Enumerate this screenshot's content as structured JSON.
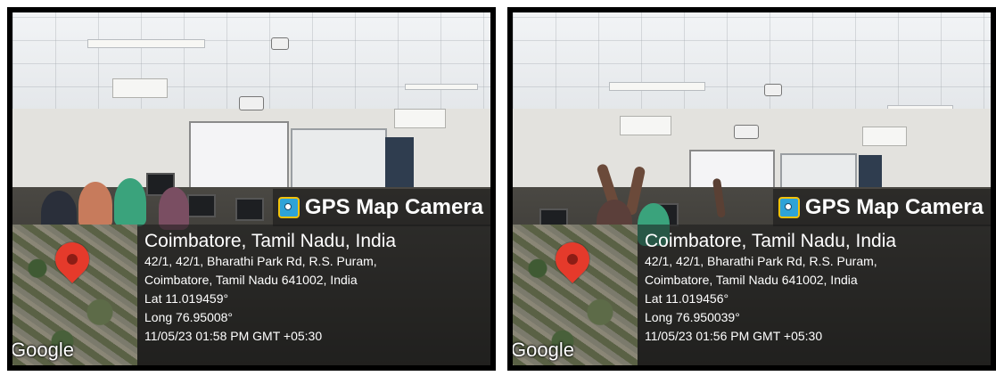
{
  "photos": [
    {
      "app_title": "GPS Map Camera",
      "location_title": "Coimbatore, Tamil Nadu, India",
      "address_line1": "42/1, 42/1, Bharathi Park Rd, R.S. Puram,",
      "address_line2": "Coimbatore, Tamil Nadu 641002, India",
      "lat": "Lat 11.019459°",
      "long": "Long 76.95008°",
      "datetime": "11/05/23 01:58 PM GMT +05:30",
      "map_logo": "Google",
      "icon": "camera-app-icon",
      "pin_icon": "location-pin-icon"
    },
    {
      "app_title": "GPS Map Camera",
      "location_title": "Coimbatore, Tamil Nadu, India",
      "address_line1": "42/1, 42/1, Bharathi Park Rd, R.S. Puram,",
      "address_line2": "Coimbatore, Tamil Nadu 641002, India",
      "lat": "Lat 11.019456°",
      "long": "Long 76.950039°",
      "datetime": "11/05/23 01:56 PM GMT +05:30",
      "map_logo": "Google",
      "icon": "camera-app-icon",
      "pin_icon": "location-pin-icon"
    }
  ],
  "colors": {
    "pin": "#e53a2b",
    "overlay": "rgba(20,20,20,0.55)",
    "text": "#ffffff"
  }
}
